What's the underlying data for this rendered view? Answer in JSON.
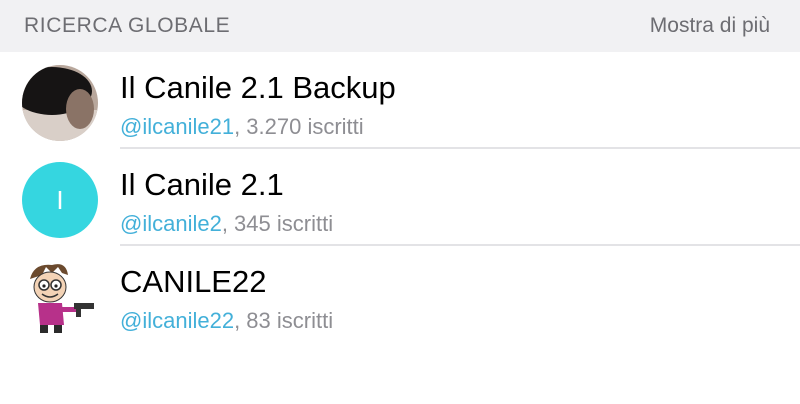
{
  "header": {
    "title": "RICERCA GLOBALE",
    "show_more": "Mostra di più"
  },
  "results": [
    {
      "name": "Il Canile 2.1 Backup",
      "handle": "@ilcanile21",
      "members": ", 3.270 iscritti",
      "avatar": "photo-avatar"
    },
    {
      "name": "Il Canile 2.1",
      "handle": "@ilcanile2",
      "members": ", 345 iscritti",
      "avatar": "letter-avatar",
      "avatar_letter": "I",
      "avatar_color": "#35d6e0"
    },
    {
      "name": "CANILE22",
      "handle": "@ilcanile22",
      "members": ", 83 iscritti",
      "avatar": "cartoon-avatar"
    }
  ],
  "colors": {
    "header_bg": "#f1f1f3",
    "handle": "#43b0d9",
    "secondary_text": "#8e8e93"
  }
}
